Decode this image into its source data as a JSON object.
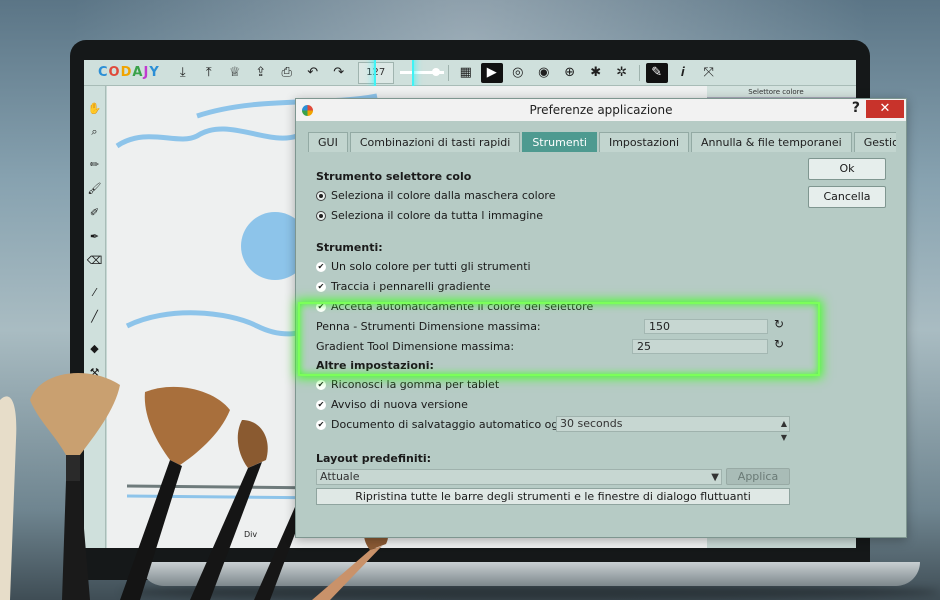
{
  "host_app": {
    "logo": "CODAJY",
    "brush_size": "127",
    "right_panel_title": "Selettore colore",
    "bottom_label": "Div"
  },
  "dialog": {
    "title": "Preferenze applicazione",
    "help_glyph": "?",
    "close_glyph": "✕",
    "tabs": [
      {
        "label": "GUI",
        "active": false
      },
      {
        "label": "Combinazioni di tasti rapidi",
        "active": false
      },
      {
        "label": "Strumenti",
        "active": true
      },
      {
        "label": "Impostazioni",
        "active": false
      },
      {
        "label": "Annulla & file temporanei",
        "active": false
      },
      {
        "label": "Gestione della librer",
        "active": false
      }
    ],
    "ok_label": "Ok",
    "cancel_label": "Cancella",
    "color_picker": {
      "title": "Strumento selettore colo",
      "option1": "Seleziona il colore dalla maschera colore",
      "option2": "Seleziona il colore da tutta l immagine"
    },
    "tools": {
      "title": "Strumenti:",
      "opt1": "Un solo colore per tutti gli strumenti",
      "opt2": "Traccia i pennarelli gradiente",
      "opt3": "Accetta automaticamente il colore del selettore",
      "pen_label": "Penna - Strumenti Dimensione massima:",
      "pen_value": "150",
      "gradient_label": "Gradient Tool Dimensione massima:",
      "gradient_value": "25"
    },
    "other": {
      "title": "Altre impostazioni:",
      "opt1": "Riconosci la gomma per tablet",
      "opt2": "Avviso di nuova versione",
      "autosave_label": "Documento di salvataggio automatico ogni:",
      "autosave_value": "30 seconds"
    },
    "layout": {
      "title": "Layout predefiniti:",
      "selected": "Attuale",
      "apply_label": "Applica",
      "reset_label": "Ripristina tutte le barre degli strumenti e le finestre di dialogo fluttuanti"
    }
  },
  "colors": {
    "active_tab": "#4e9a90",
    "highlight_green": "#46ff2a",
    "highlight_cyan": "#3ff3f5",
    "close_red": "#c8332b",
    "stroke_blue": "#8dc4ea"
  }
}
